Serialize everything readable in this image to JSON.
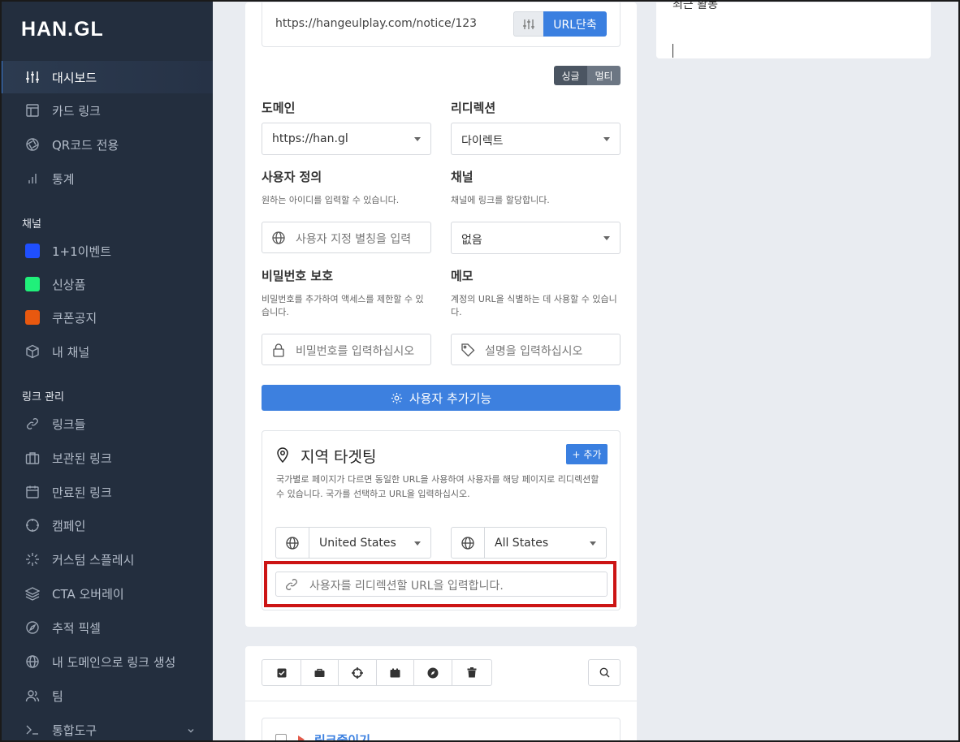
{
  "sidebar": {
    "logo": "HAN.GL",
    "primary": [
      {
        "label": "대시보드",
        "icon": "sliders-icon",
        "active": true
      },
      {
        "label": "카드 링크",
        "icon": "layout-icon"
      },
      {
        "label": "QR코드 전용",
        "icon": "aperture-icon"
      },
      {
        "label": "통계",
        "icon": "bar-chart-icon"
      }
    ],
    "channels_heading": "채널",
    "channels": [
      {
        "label": "1+1이벤트",
        "color": "#1f4fff"
      },
      {
        "label": "신상품",
        "color": "#20f07a"
      },
      {
        "label": "쿠폰공지",
        "color": "#e8580f"
      },
      {
        "label": "내 채널",
        "icon": "box-icon"
      }
    ],
    "links_heading": "링크 관리",
    "links": [
      {
        "label": "링크들",
        "icon": "link-icon"
      },
      {
        "label": "보관된 링크",
        "icon": "briefcase-icon"
      },
      {
        "label": "만료된 링크",
        "icon": "calendar-icon"
      },
      {
        "label": "캠페인",
        "icon": "crosshair-icon"
      },
      {
        "label": "커스텀 스플레시",
        "icon": "loader-icon"
      },
      {
        "label": "CTA 오버레이",
        "icon": "layers-icon"
      },
      {
        "label": "추적 픽셀",
        "icon": "compass-icon"
      },
      {
        "label": "내 도메인으로 링크 생성",
        "icon": "globe-icon"
      },
      {
        "label": "팀",
        "icon": "users-icon"
      },
      {
        "label": "통합도구",
        "icon": "terminal-icon"
      }
    ]
  },
  "shortener": {
    "url_value": "https://hangeulplay.com/notice/123",
    "shorten_label": "URL단축"
  },
  "mode": {
    "single": "싱글",
    "multi": "멀티"
  },
  "form": {
    "domain_label": "도메인",
    "domain_value": "https://han.gl",
    "redirect_label": "리디렉션",
    "redirect_value": "다이렉트",
    "custom_label": "사용자 정의",
    "custom_help": "원하는 아이디를 입력할 수 있습니다.",
    "custom_placeholder": "사용자 지정 별칭을 입력",
    "channel_label": "채널",
    "channel_help": "채널에 링크를 할당합니다.",
    "channel_value": "없음",
    "password_label": "비밀번호 보호",
    "password_help": "비밀번호를 추가하여 액세스를 제한할 수 있습니다.",
    "password_placeholder": "비밀번호를 입력하십시오",
    "memo_label": "메모",
    "memo_help": "계정의 URL을 식별하는 데 사용할 수 있습니다.",
    "memo_placeholder": "설명을 입력하십시오",
    "advanced_label": "사용자 추가기능"
  },
  "geo": {
    "title": "지역 타겟팅",
    "add_label": "+ 추가",
    "description": "국가별로 페이지가 다르면 동일한 URL을 사용하여 사용자를 해당 페이지로 리디렉션할 수 있습니다. 국가를 선택하고 URL을 입력하십시오.",
    "country_value": "United States",
    "state_value": "All States",
    "url_placeholder": "사용자를 리디렉션할 URL을 입력합니다."
  },
  "toolbar": {
    "icons": [
      "check-square-icon",
      "briefcase-icon",
      "crosshair-icon",
      "archive-icon",
      "compass-icon",
      "trash-icon"
    ]
  },
  "list": {
    "first_title": "링크줄이기"
  },
  "right_panel": {
    "title": "최근 활동"
  }
}
